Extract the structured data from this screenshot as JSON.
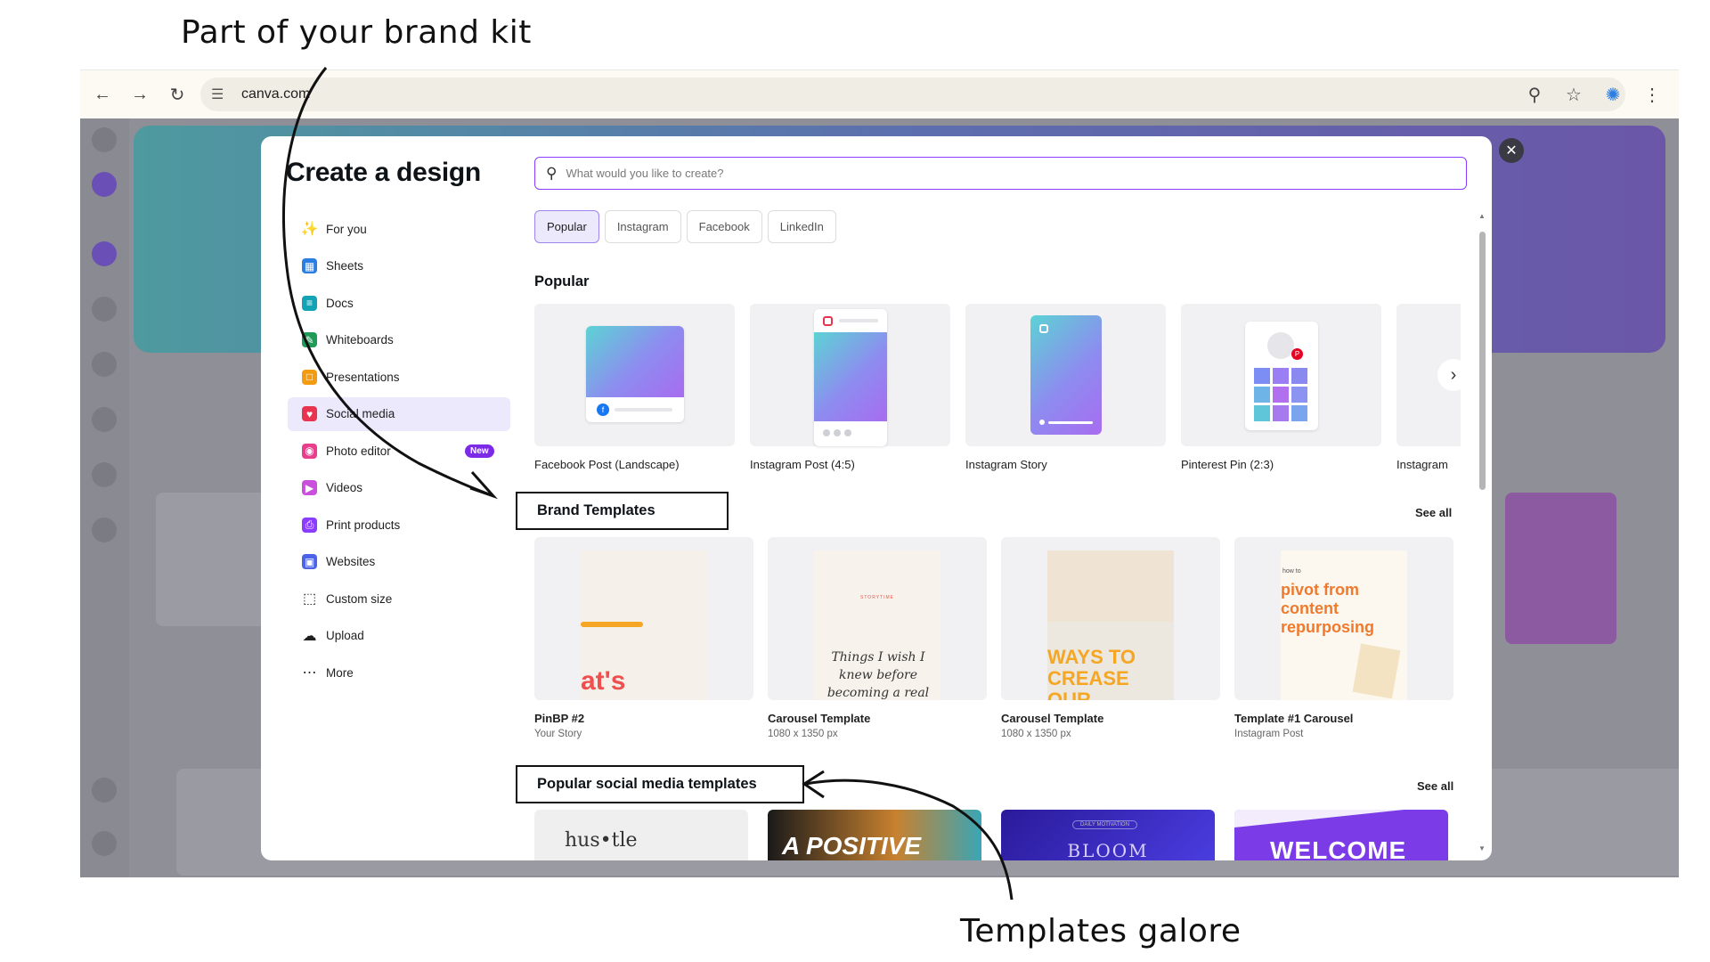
{
  "annotations": {
    "top": "Part of your brand kit",
    "bottom": "Templates galore"
  },
  "browser": {
    "url": "canva.com"
  },
  "modal": {
    "title": "Create a design",
    "search_placeholder": "What would you like to create?",
    "nav": [
      {
        "label": "For you",
        "icon": "sparkle-icon"
      },
      {
        "label": "Sheets",
        "icon": "sheets-icon",
        "color": "#2a7de1"
      },
      {
        "label": "Docs",
        "icon": "docs-icon",
        "color": "#13a3b5"
      },
      {
        "label": "Whiteboards",
        "icon": "whiteboard-icon",
        "color": "#1f9b57"
      },
      {
        "label": "Presentations",
        "icon": "presentation-icon",
        "color": "#f39c12"
      },
      {
        "label": "Social media",
        "icon": "heart-icon",
        "color": "#e8344e"
      },
      {
        "label": "Photo editor",
        "icon": "camera-icon",
        "color": "#e83e8c",
        "badge": "New"
      },
      {
        "label": "Videos",
        "icon": "video-icon",
        "color": "#c94fdc"
      },
      {
        "label": "Print products",
        "icon": "printer-icon",
        "color": "#8b3dff"
      },
      {
        "label": "Websites",
        "icon": "website-icon",
        "color": "#4a63e8"
      },
      {
        "label": "Custom size",
        "icon": "crop-icon"
      },
      {
        "label": "Upload",
        "icon": "upload-cloud-icon"
      },
      {
        "label": "More",
        "icon": "more-icon"
      }
    ],
    "chips": [
      "Popular",
      "Instagram",
      "Facebook",
      "LinkedIn"
    ],
    "popular": {
      "title": "Popular",
      "items": [
        "Facebook Post (Landscape)",
        "Instagram Post (4:5)",
        "Instagram Story",
        "Pinterest Pin (2:3)",
        "Instagram"
      ]
    },
    "brand_templates": {
      "title": "Brand Templates",
      "see_all": "See all",
      "items": [
        {
          "name": "PinBP #2",
          "sub": "Your Story",
          "preview": "at's"
        },
        {
          "name": "Carousel Template",
          "sub": "1080 x 1350 px",
          "preview": "Things I wish I knew before becoming a real estate agent",
          "kicker": "STORYTIME"
        },
        {
          "name": "Carousel Template",
          "sub": "1080 x 1350 px",
          "preview": "WAYS TO CREASE OUR REACH"
        },
        {
          "name": "Template #1 Carousel",
          "sub": "Instagram Post",
          "preview": "pivot from content repurposing",
          "kicker": "how to"
        }
      ]
    },
    "social": {
      "title": "Popular social media templates",
      "see_all": "See all",
      "items": [
        "hus•tle",
        "A POSITIVE",
        "BLOOM",
        "WELCOME"
      ],
      "tagline": "DAILY MOTIVATION"
    }
  }
}
